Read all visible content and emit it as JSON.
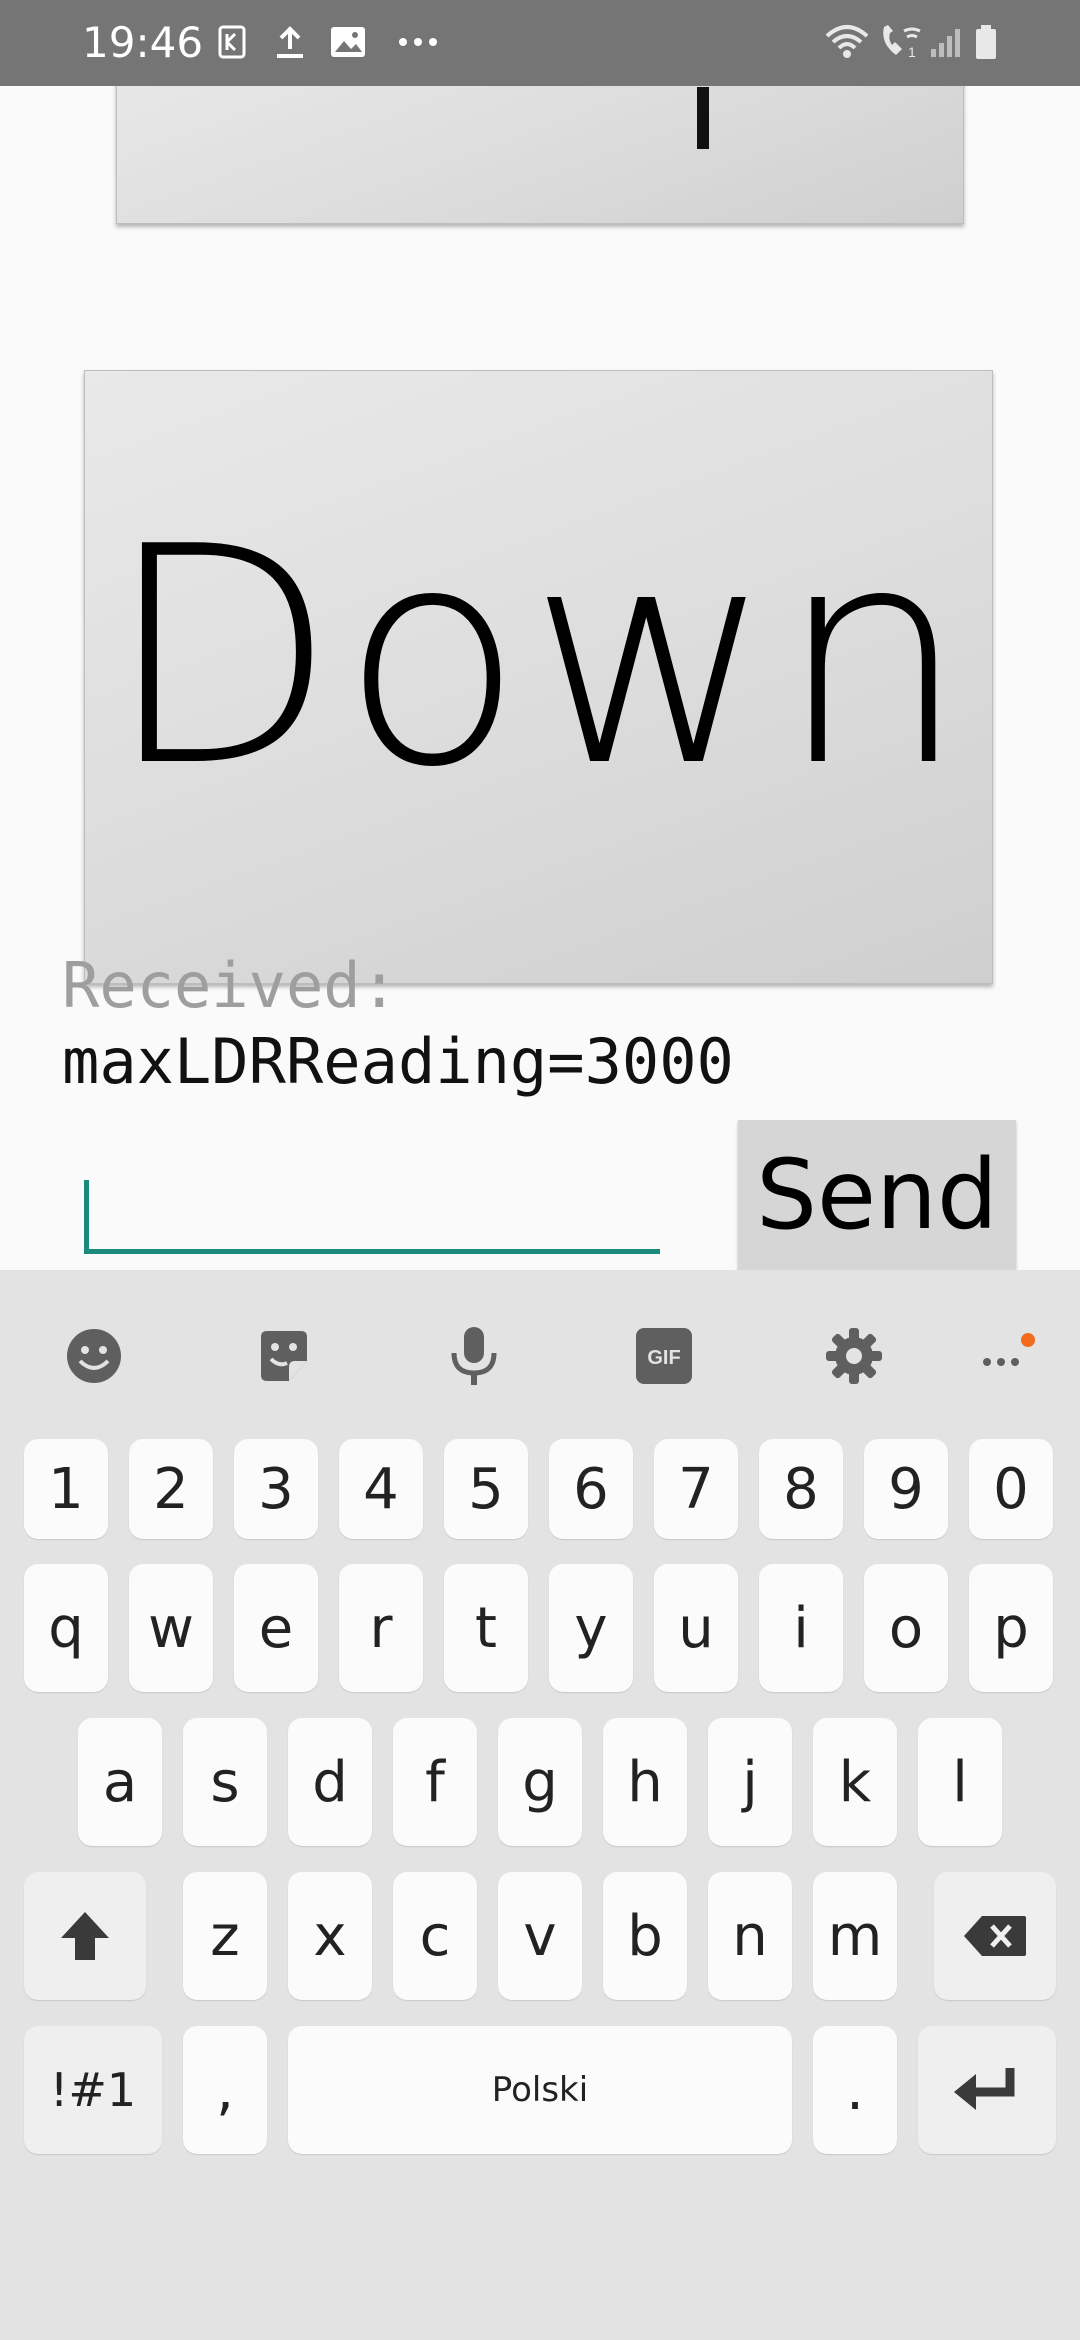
{
  "status_bar": {
    "time": "19:46",
    "left_icons": [
      "k-notification-icon",
      "upload-icon",
      "image-icon",
      "more-dots-icon"
    ],
    "right_icons": [
      "wifi-icon",
      "wifi-calling-icon",
      "signal-icon",
      "battery-icon"
    ]
  },
  "app": {
    "down_button_label": "Down",
    "received_label": "Received:",
    "received_value": "maxLDRReading=3000",
    "message_input_value": "",
    "send_button_label": "Send"
  },
  "keyboard": {
    "toolbar": [
      "emoji-icon",
      "sticker-icon",
      "microphone-icon",
      "gif-icon",
      "settings-icon",
      "more-options-icon"
    ],
    "gif_label": "GIF",
    "number_row": [
      "1",
      "2",
      "3",
      "4",
      "5",
      "6",
      "7",
      "8",
      "9",
      "0"
    ],
    "row1": [
      "q",
      "w",
      "e",
      "r",
      "t",
      "y",
      "u",
      "i",
      "o",
      "p"
    ],
    "row2": [
      "a",
      "s",
      "d",
      "f",
      "g",
      "h",
      "j",
      "k",
      "l"
    ],
    "row3": [
      "z",
      "x",
      "c",
      "v",
      "b",
      "n",
      "m"
    ],
    "symbols_label": "!#1",
    "comma_label": ",",
    "space_label": "Polski",
    "period_label": ".",
    "colors": {
      "accent": "#1a8a7c",
      "notification_dot": "#f26b1d"
    }
  }
}
